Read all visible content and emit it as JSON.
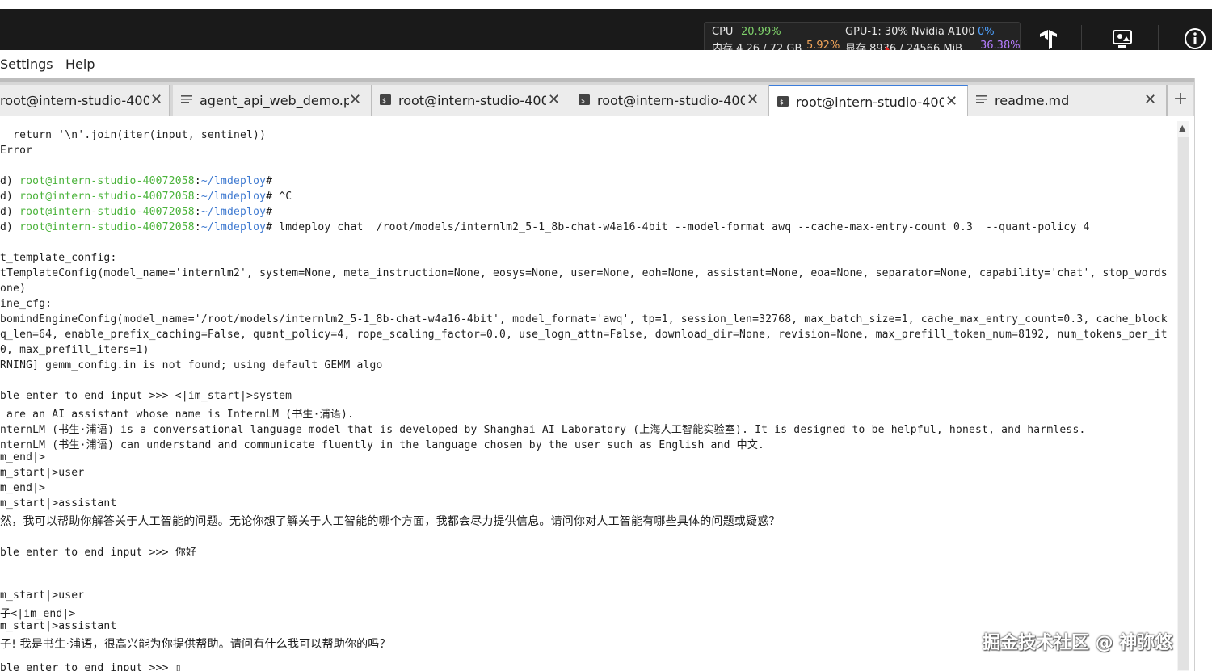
{
  "topbar": {
    "cpu_label": "CPU",
    "cpu_value": "20.99%",
    "mem_label": "内存 4.26 / 72 GB",
    "mem_value": "5.92%",
    "gpu_label": "GPU-1: 30% Nvidia A100",
    "gpu_value": "0%",
    "vram_label": "显存 8936 / 24566 MiB",
    "vram_value": "36.38%",
    "icons": [
      "tensorflow-icon",
      "monitor-icon",
      "info-icon"
    ]
  },
  "menu": {
    "items": [
      "Settings",
      "Help"
    ]
  },
  "tabs": [
    {
      "label": "root@intern-studio-400",
      "icon": "terminal-icon"
    },
    {
      "label": "agent_api_web_demo.p",
      "icon": "file-icon"
    },
    {
      "label": "root@intern-studio-400",
      "icon": "terminal-icon"
    },
    {
      "label": "root@intern-studio-400",
      "icon": "terminal-icon"
    },
    {
      "label": "root@intern-studio-400",
      "icon": "terminal-icon"
    },
    {
      "label": "readme.md",
      "icon": "file-icon"
    }
  ],
  "terminal": {
    "user_host": "root@intern-studio-40072058",
    "path": "~/lmdeploy",
    "lines": [
      "  return '\\n'.join(iter(input, sentinel))",
      "Error",
      "",
      "d) ",
      "d) ",
      "d) ",
      "d) ",
      "",
      "t_template_config:",
      "tTemplateConfig(model_name='internlm2', system=None, meta_instruction=None, eosys=None, user=None, eoh=None, assistant=None, eoa=None, separator=None, capability='chat', stop_words",
      "one)",
      "ine_cfg:",
      "bomindEngineConfig(model_name='/root/models/internlm2_5-1_8b-chat-w4a16-4bit', model_format='awq', tp=1, session_len=32768, max_batch_size=1, cache_max_entry_count=0.3, cache_block",
      "q_len=64, enable_prefix_caching=False, quant_policy=4, rope_scaling_factor=0.0, use_logn_attn=False, download_dir=None, revision=None, max_prefill_token_num=8192, num_tokens_per_it",
      "0, max_prefill_iters=1)",
      "RNING] gemm_config.in is not found; using default GEMM algo",
      "",
      "ble enter to end input >>> <|im_start|>system",
      " are an AI assistant whose name is InternLM (书生·浦语).",
      "nternLM (书生·浦语) is a conversational language model that is developed by Shanghai AI Laboratory (上海人工智能实验室). It is designed to be helpful, honest, and harmless.",
      "nternLM (书生·浦语) can understand and communicate fluently in the language chosen by the user such as English and 中文.",
      "m_end|>",
      "m_start|>user",
      "m_end|>",
      "m_start|>assistant",
      "然，我可以帮助你解答关于人工智能的问题。无论你想了解关于人工智能的哪个方面，我都会尽力提供信息。请问你对人工智能有哪些具体的问题或疑惑？",
      "",
      "ble enter to end input >>> 你好",
      "",
      "",
      "m_start|>user",
      "子<|im_end|>",
      "m_start|>assistant",
      "子! 我是书生·浦语，很高兴能为你提供帮助。请问有什么我可以帮助你的吗？",
      "",
      "ble enter to end input >>> ▯"
    ],
    "prompt_suffixes": [
      "#",
      "# ^C",
      "#",
      "# lmdeploy chat  /root/models/internlm2_5-1_8b-chat-w4a16-4bit --model-format awq --cache-max-entry-count 0.3  --quant-policy 4"
    ]
  },
  "watermark": "掘金技术社区 @ 神弥悠"
}
